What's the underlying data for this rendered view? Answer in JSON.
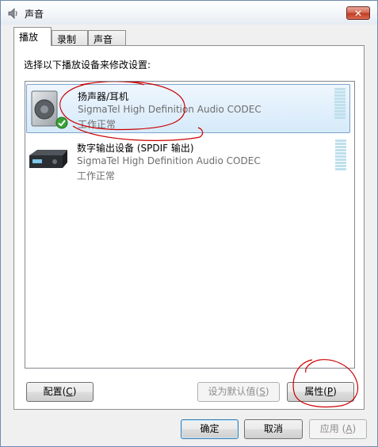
{
  "window": {
    "title": "声音",
    "close_label": "✕"
  },
  "tabs": [
    {
      "label": "播放",
      "active": true
    },
    {
      "label": "录制",
      "active": false
    },
    {
      "label": "声音",
      "active": false
    }
  ],
  "playback": {
    "prompt": "选择以下播放设备来修改设置:",
    "devices": [
      {
        "name": "扬声器/耳机",
        "driver": "SigmaTel High Definition Audio CODEC",
        "status": "工作正常",
        "icon": "speaker-icon",
        "is_default": true,
        "selected": true
      },
      {
        "name": "数字输出设备 (SPDIF 输出)",
        "driver": "SigmaTel High Definition Audio CODEC",
        "status": "工作正常",
        "icon": "digital-output-icon",
        "is_default": false,
        "selected": false
      }
    ],
    "buttons": {
      "configure": {
        "text": "配置(",
        "key": "C",
        "end": ")"
      },
      "set_default": {
        "text": "设为默认值(",
        "key": "S",
        "end": ")"
      },
      "properties": {
        "text": "属性(",
        "key": "P",
        "end": ")"
      }
    }
  },
  "footer": {
    "ok": "确定",
    "cancel": "取消",
    "apply": {
      "text": "应用 (",
      "key": "A",
      "end": ")"
    }
  },
  "colors": {
    "selection": "#d6eafa",
    "annotation": "#cc0000",
    "meter": "#bfe0ec"
  }
}
